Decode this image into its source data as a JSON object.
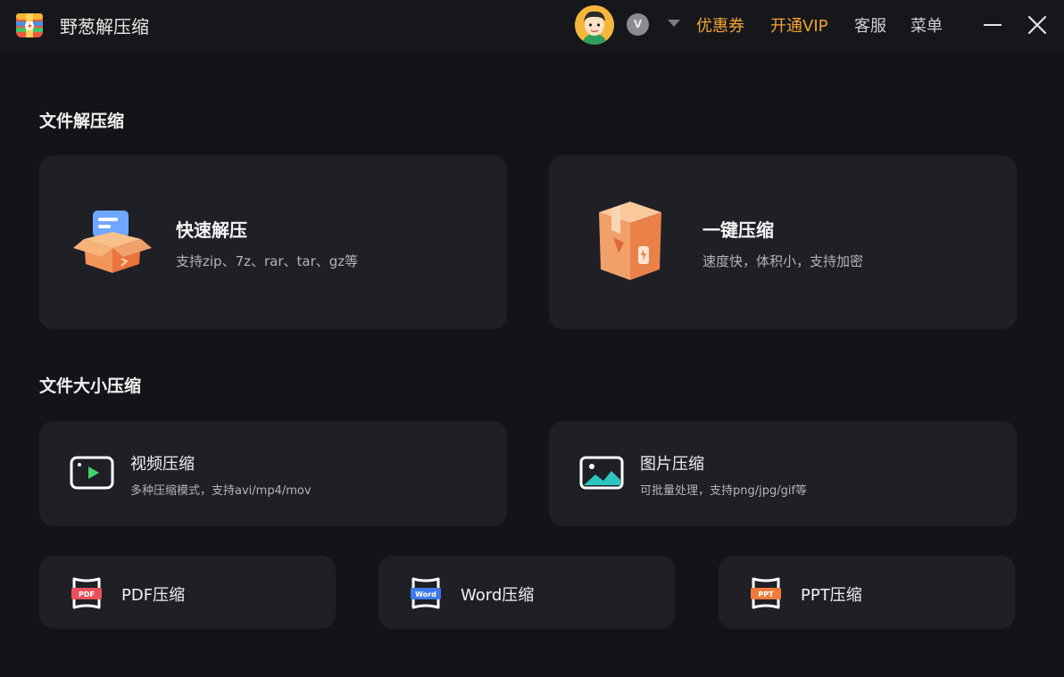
{
  "app": {
    "title": "野葱解压缩"
  },
  "header": {
    "vip_badge": "V",
    "links": {
      "coupon": "优惠券",
      "vip": "开通VIP",
      "service": "客服",
      "menu": "菜单"
    }
  },
  "sections": {
    "decompress": {
      "title": "文件解压缩",
      "cards": {
        "quick": {
          "title": "快速解压",
          "subtitle": "支持zip、7z、rar、tar、gz等",
          "icon": "open-box-icon"
        },
        "oneclick": {
          "title": "一键压缩",
          "subtitle": "速度快，体积小，支持加密",
          "icon": "closed-box-icon"
        }
      }
    },
    "size": {
      "title": "文件大小压缩",
      "cards": {
        "video": {
          "title": "视频压缩",
          "subtitle": "多种压缩模式，支持avi/mp4/mov",
          "icon": "video-icon"
        },
        "image": {
          "title": "图片压缩",
          "subtitle": "可批量处理，支持png/jpg/gif等",
          "icon": "image-icon"
        },
        "pdf": {
          "title": "PDF压缩",
          "badge": "PDF",
          "icon": "pdf-file-icon"
        },
        "word": {
          "title": "Word压缩",
          "badge": "Word",
          "icon": "word-file-icon"
        },
        "ppt": {
          "title": "PPT压缩",
          "badge": "PPT",
          "icon": "ppt-file-icon"
        }
      }
    }
  },
  "colors": {
    "background": "#131418",
    "card": "#1f2026",
    "accent": "#f4a431",
    "pdf": "#e8515b",
    "word": "#3f79e8",
    "ppt": "#f07a3a",
    "video_play": "#3fd46e",
    "image_teal": "#2ec7c0"
  }
}
